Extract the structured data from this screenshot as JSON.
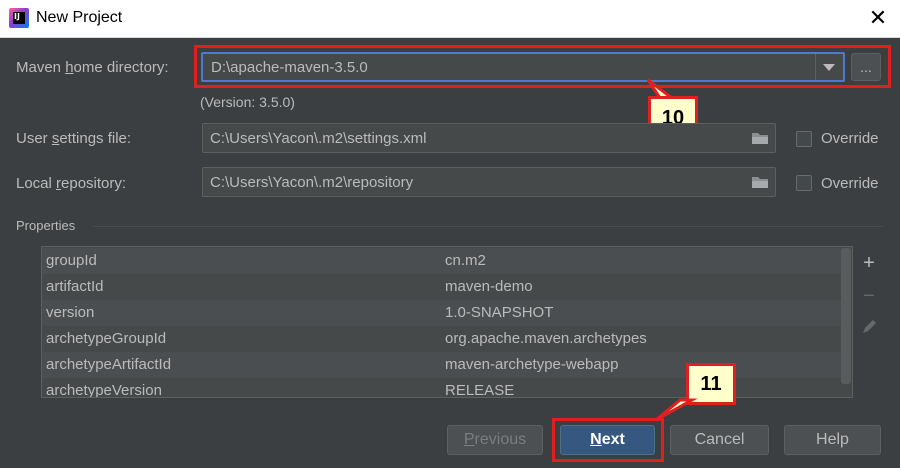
{
  "window": {
    "title": "New Project",
    "close_label": "✕"
  },
  "maven_home": {
    "label_before": "Maven ",
    "label_mnemonic": "h",
    "label_after": "ome directory:",
    "value": "D:\\apache-maven-3.5.0",
    "browse_label": "...",
    "version_text": "(Version: 3.5.0)"
  },
  "user_settings": {
    "label_before": "User ",
    "label_mnemonic": "s",
    "label_after": "ettings file:",
    "value": "C:\\Users\\Yacon\\.m2\\settings.xml",
    "override_label": "Override"
  },
  "local_repo": {
    "label_before": "Local ",
    "label_mnemonic": "r",
    "label_after": "epository:",
    "value": "C:\\Users\\Yacon\\.m2\\repository",
    "override_label": "Override"
  },
  "properties": {
    "section_label": "Properties",
    "rows": [
      {
        "key": "groupId",
        "value": "cn.m2"
      },
      {
        "key": "artifactId",
        "value": "maven-demo"
      },
      {
        "key": "version",
        "value": "1.0-SNAPSHOT"
      },
      {
        "key": "archetypeGroupId",
        "value": "org.apache.maven.archetypes"
      },
      {
        "key": "archetypeArtifactId",
        "value": "maven-archetype-webapp"
      },
      {
        "key": "archetypeVersion",
        "value": "RELEASE"
      }
    ],
    "add_icon": "+",
    "remove_icon": "−"
  },
  "callouts": {
    "step10": "10",
    "step11": "11"
  },
  "buttons": {
    "previous_mnemonic": "P",
    "previous_rest": "revious",
    "next_mnemonic": "N",
    "next_rest": "ext",
    "cancel": "Cancel",
    "help": "Help"
  },
  "colors": {
    "background": "#3c3f41",
    "accent": "#365880",
    "annotation": "#e02020"
  },
  "icons": [
    "app-icon",
    "close-icon",
    "dropdown-arrow-icon",
    "folder-icon",
    "add-icon",
    "remove-icon",
    "edit-icon"
  ]
}
